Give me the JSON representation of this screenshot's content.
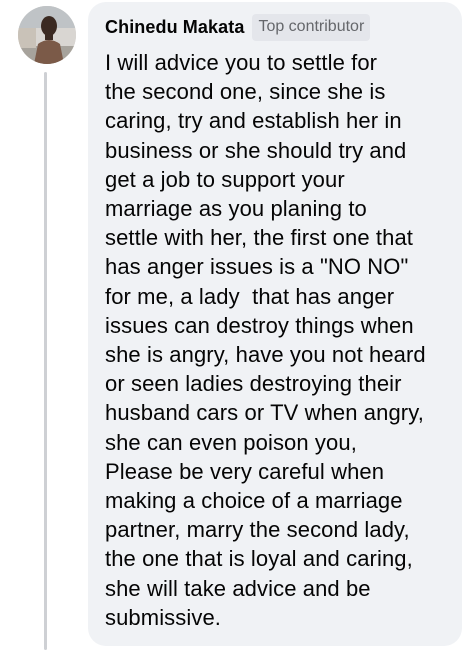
{
  "comment": {
    "author_name": "Chinedu Makata",
    "badge": "Top contributor",
    "avatar_icon": "user-photo-avatar",
    "lines": [
      "I will advice you to settle for",
      "the second one, since she is",
      "caring, try and establish her in",
      "business or she should try and",
      "get a job to support your",
      "marriage as you planing to",
      "settle with her, the first one that",
      "has anger issues is a \"NO NO\"",
      "for me, a lady  that has anger",
      "issues can destroy things when",
      "she is angry, have you not heard",
      "or seen ladies destroying their",
      "husband cars or TV when angry,",
      "she can even poison you,",
      "Please be very careful when",
      "making a choice of a marriage",
      "partner, marry the second lady,",
      "the one that is loyal and caring,",
      "she will take advice and be",
      "submissive."
    ]
  },
  "colors": {
    "bubble_bg": "#f0f2f5",
    "badge_bg": "#e4e6eb",
    "badge_text": "#65676b",
    "text": "#050505",
    "thread_line": "#ced0d4"
  }
}
